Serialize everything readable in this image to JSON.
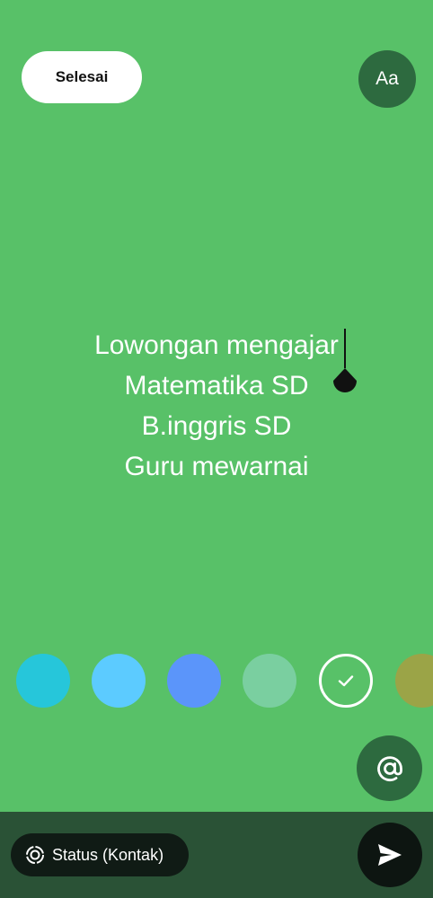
{
  "colors": {
    "background": "#58c168",
    "dark_green": "#2d6a3f",
    "bottom_bar": "#2a5236",
    "chip": "#101b15",
    "send": "#0d1511"
  },
  "toolbar": {
    "done_label": "Selesai",
    "font_label": "Aa"
  },
  "status": {
    "lines": [
      "Lowongan mengajar",
      "Matematika SD",
      "B.inggris SD",
      "Guru mewarnai"
    ]
  },
  "palette": {
    "swatches": [
      {
        "color": "#26c6da",
        "selected": false
      },
      {
        "color": "#5ccbff",
        "selected": false
      },
      {
        "color": "#5b95fa",
        "selected": false
      },
      {
        "color": "#7acfa0",
        "selected": false
      },
      {
        "color": "#58c168",
        "selected": true
      },
      {
        "color": "#9ba447",
        "selected": false
      }
    ]
  },
  "bottom_bar": {
    "audience_label": "Status (Kontak)"
  },
  "icons": {
    "mention": "at-sign-icon",
    "audience": "status-icon",
    "send": "send-icon",
    "selected": "check-icon"
  }
}
